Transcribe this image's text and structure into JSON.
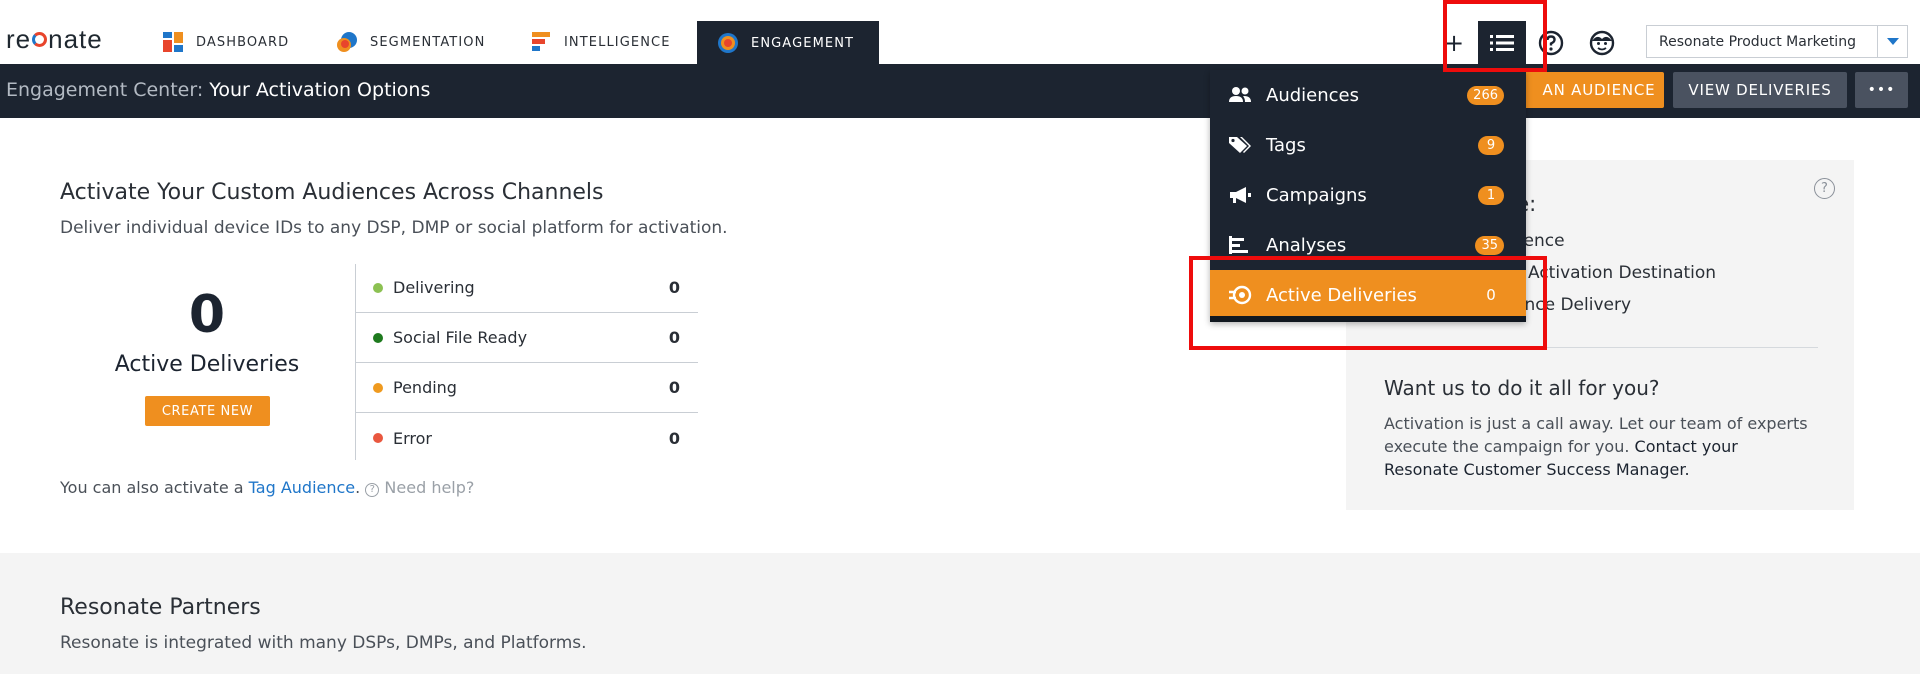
{
  "app": {
    "logo_text": "resonate"
  },
  "nav": {
    "tabs": [
      {
        "label": "DASHBOARD",
        "icon": "dashboard-icon"
      },
      {
        "label": "SEGMENTATION",
        "icon": "segmentation-icon"
      },
      {
        "label": "INTELLIGENCE",
        "icon": "intelligence-icon"
      },
      {
        "label": "ENGAGEMENT",
        "icon": "engagement-icon",
        "active": true
      }
    ],
    "tools": {
      "add": "+",
      "list_icon": "list-icon",
      "help_icon": "help-icon",
      "profile_icon": "profile-icon"
    },
    "account": "Resonate Product Marketing"
  },
  "header": {
    "breadcrumb_prefix": "Engagement Center:",
    "breadcrumb_title": "Your Activation Options",
    "activate_button": "AN AUDIENCE",
    "view_deliveries_button": "VIEW DELIVERIES",
    "more_button": "•••"
  },
  "main": {
    "title": "Activate Your Custom Audiences Across Channels",
    "subtitle": "Deliver individual device IDs to any DSP, DMP or social platform for activation.",
    "total_value": "0",
    "total_label": "Active Deliveries",
    "create_button": "CREATE NEW",
    "statuses": [
      {
        "label": "Delivering",
        "value": "0",
        "color": "#8cc152"
      },
      {
        "label": "Social File Ready",
        "value": "0",
        "color": "#1e7a1e"
      },
      {
        "label": "Pending",
        "value": "0",
        "color": "#ef9a1f"
      },
      {
        "label": "Error",
        "value": "0",
        "color": "#e9573f"
      }
    ],
    "footnote_prefix": "You can also activate a",
    "footnote_link": "Tag Audience",
    "footnote_suffix": ".",
    "help_link": "Need help?"
  },
  "right_panel": {
    "heading_partial": "te:",
    "step1_partial": "dience",
    "step2_partial": "Activation Destination",
    "step3_partial": "ence Delivery",
    "cta_title": "Want us to do it all for you?",
    "cta_body_1": "Activation is just a call away. Let our team of experts",
    "cta_body_2": "execute the campaign for you.",
    "cta_body_bold_1": "Contact your",
    "cta_body_bold_2": "Resonate Customer Success Manager."
  },
  "partners": {
    "title": "Resonate Partners",
    "subtitle": "Resonate is integrated with many DSPs, DMPs, and Platforms."
  },
  "dropdown": {
    "items": [
      {
        "label": "Audiences",
        "count": "266",
        "icon": "people-icon"
      },
      {
        "label": "Tags",
        "count": "9",
        "icon": "tags-icon"
      },
      {
        "label": "Campaigns",
        "count": "1",
        "icon": "megaphone-icon"
      },
      {
        "label": "Analyses",
        "count": "35",
        "icon": "analyses-icon"
      },
      {
        "label": "Active Deliveries",
        "count": "0",
        "icon": "deliveries-icon",
        "active": true
      }
    ]
  },
  "colors": {
    "accent": "#ef8f1f",
    "dark": "#1c2430",
    "link": "#1f76c9",
    "highlight": "#ee0c0c"
  }
}
